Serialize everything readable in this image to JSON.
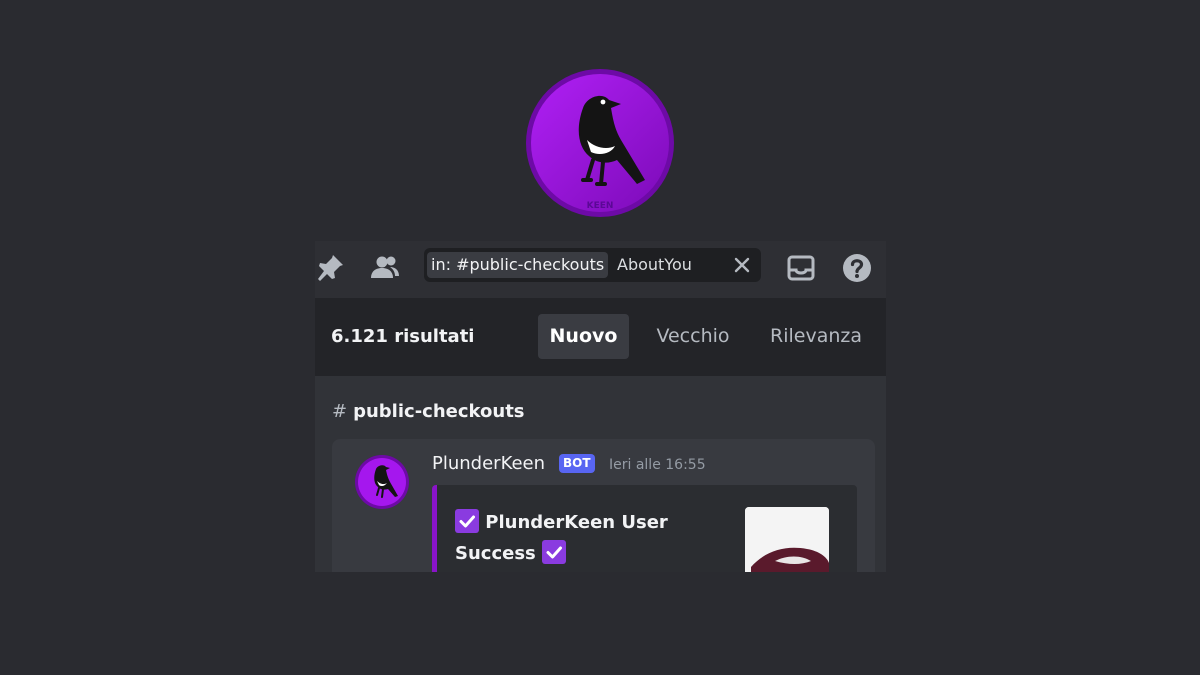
{
  "brand": {
    "logo_icon": "magpie-bird-icon",
    "logo_text": "KEEN",
    "accent": "#9a0fd6"
  },
  "toolbar": {
    "icons": [
      "pin-icon",
      "members-icon",
      "inbox-icon",
      "help-icon"
    ],
    "search": {
      "filter_chip": "in: #public-checkouts",
      "query": "AboutYou",
      "clear_icon": "close-icon"
    }
  },
  "results": {
    "count_label": "6.121 risultati",
    "sort_tabs": [
      {
        "label": "Nuovo",
        "active": true
      },
      {
        "label": "Vecchio",
        "active": false
      },
      {
        "label": "Rilevanza",
        "active": false
      }
    ]
  },
  "channel": {
    "name": "public-checkouts",
    "icon": "hashtag-icon"
  },
  "message": {
    "author": "PlunderKeen",
    "badge": "BOT",
    "timestamp": "Ieri alle 16:55",
    "embed": {
      "title_part1": "PlunderKeen User",
      "title_part2": "Success",
      "check_icon": "checkbox-check-icon",
      "thumbnail_icon": "sneaker-image",
      "border_color": "#8a14c9"
    }
  }
}
